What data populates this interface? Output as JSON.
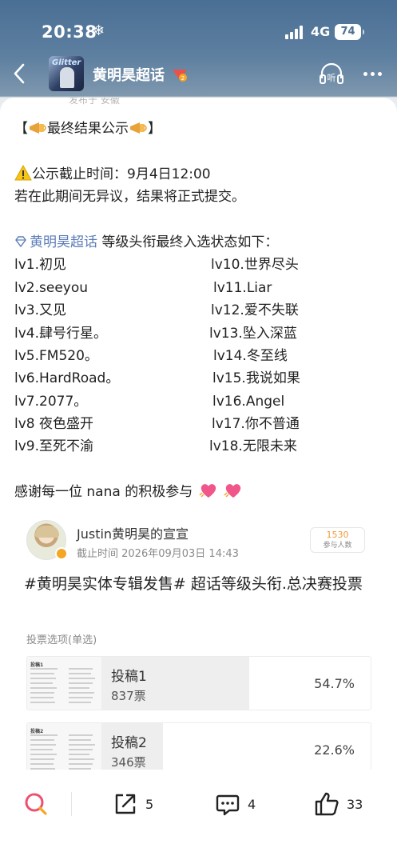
{
  "status_bar": {
    "time": "20:38",
    "weather_icon": "snowflake-icon",
    "network": "4G",
    "battery": "74"
  },
  "nav": {
    "title": "黄明昊超话",
    "avatar_text": "Glitter"
  },
  "peek_text": "发布于 安徽",
  "post": {
    "header": "最终结果公示",
    "deadline": "公示截止时间：9月4日12:00",
    "notice": "若在此期间无异议，结果将正式提交。",
    "topic_link": "黄明昊超话",
    "intro_suffix": " 等级头衔最终入选状态如下：",
    "levels": [
      [
        "lv1.初见",
        "lv10.世界尽头"
      ],
      [
        "lv2.seeyou",
        "lv11.Liar"
      ],
      [
        "lv3.又见",
        "lv12.爱不失联"
      ],
      [
        "lv4.肆号行星。",
        "lv13.坠入深蓝"
      ],
      [
        "lv5.FM520。",
        "lv14.冬至线"
      ],
      [
        "lv6.HardRoad。",
        "lv15.我说如果"
      ],
      [
        "lv7.2077。",
        "lv16.Angel"
      ],
      [
        "lv8 夜色盛开",
        "lv17.你不普通"
      ],
      [
        "lv9.至死不渝",
        "lv18.无限未来"
      ]
    ],
    "thanks": "感谢每一位 nana 的积极参与"
  },
  "vote": {
    "author": "Justin黄明昊的宣宣",
    "deadline": "截止时间 2026年09月03日 14:43",
    "participants": "1530",
    "participants_label": "参与人数",
    "title": "#黄明昊实体专辑发售# 超话等级头衔.总决赛投票",
    "subtitle": "投票选项(单选)",
    "options": [
      {
        "name": "投稿1",
        "votes": "837票",
        "percent": "54.7%",
        "share": 0.547,
        "thumb_label": "投稿1"
      },
      {
        "name": "投稿2",
        "votes": "346票",
        "percent": "22.6%",
        "share": 0.226,
        "thumb_label": "投稿2"
      }
    ]
  },
  "bottom_bar": {
    "share": "5",
    "comment": "4",
    "like": "33"
  },
  "colors": {
    "link": "#5b7db8",
    "accent_orange": "#f19a3e"
  }
}
